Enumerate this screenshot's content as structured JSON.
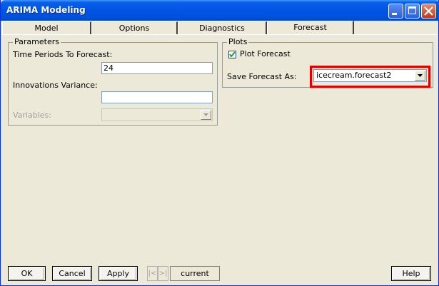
{
  "window": {
    "title": "ARIMA Modeling"
  },
  "tabs": [
    {
      "label": "Model"
    },
    {
      "label": "Options"
    },
    {
      "label": "Diagnostics"
    },
    {
      "label": "Forecast",
      "active": true
    }
  ],
  "parameters": {
    "group_label": "Parameters",
    "time_periods_label": "Time Periods To Forecast:",
    "time_periods_value": "24",
    "innovations_label": "Innovations Variance:",
    "innovations_value": "",
    "variables_label": "Variables:",
    "variables_value": ""
  },
  "plots": {
    "group_label": "Plots",
    "plot_forecast_label": "Plot Forecast",
    "plot_forecast_checked": true,
    "save_label": "Save Forecast As:",
    "save_value": "icecream.forecast2"
  },
  "footer": {
    "ok": "OK",
    "cancel": "Cancel",
    "apply": "Apply",
    "current": "current",
    "help": "Help"
  },
  "colors": {
    "highlight": "#e00000",
    "titlebar": "#0055e5"
  }
}
